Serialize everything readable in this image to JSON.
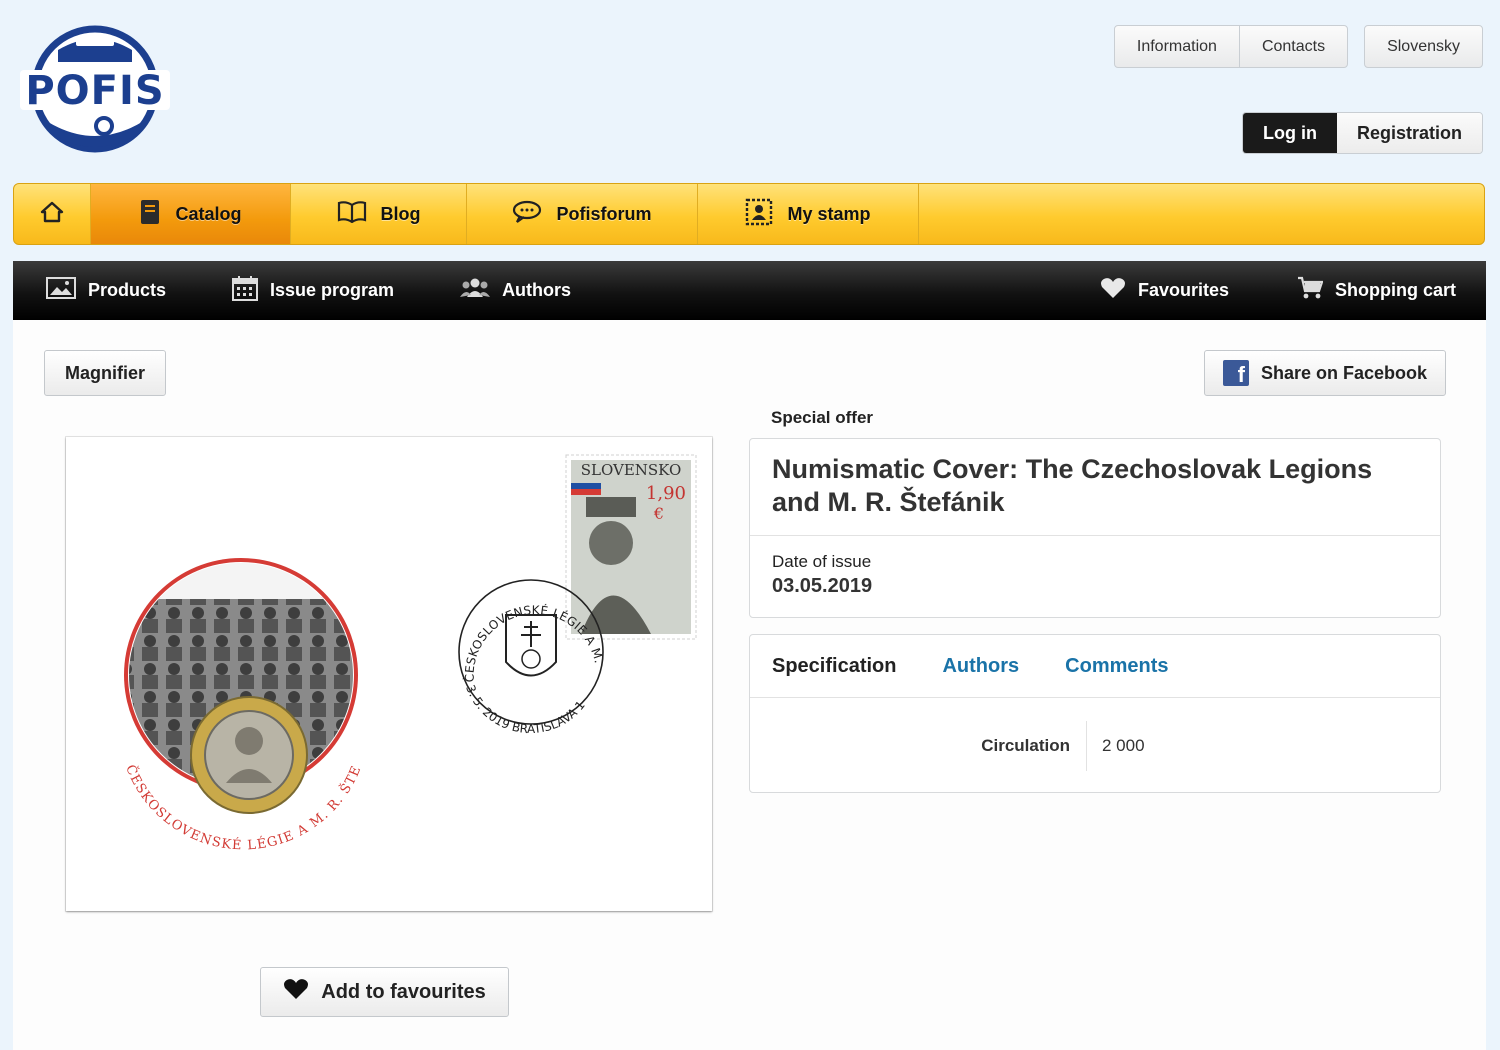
{
  "header": {
    "logo_text": "POFIS",
    "top_links": [
      "Information",
      "Contacts"
    ],
    "language": "Slovensky",
    "login": "Log in",
    "registration": "Registration"
  },
  "main_nav": {
    "items": [
      {
        "label": "Catalog",
        "icon": "catalog-book-icon"
      },
      {
        "label": "Blog",
        "icon": "open-book-icon"
      },
      {
        "label": "Pofisforum",
        "icon": "speech-bubble-icon"
      },
      {
        "label": "My stamp",
        "icon": "stamp-frame-icon"
      }
    ],
    "active": "Catalog"
  },
  "sub_nav": {
    "products": "Products",
    "issue_program": "Issue program",
    "authors": "Authors",
    "favourites": "Favourites",
    "cart": "Shopping cart"
  },
  "toolbar": {
    "magnifier": "Magnifier",
    "share": "Share on Facebook"
  },
  "product": {
    "special_offer": "Special offer",
    "title": "Numismatic Cover: The Czechoslovak Legions and M. R. Štefánik",
    "date_label": "Date of issue",
    "date_value": "03.05.2019",
    "add_favourites": "Add to favourites"
  },
  "cover": {
    "stamp_country": "SLOVENSKO",
    "stamp_value": "1,90",
    "stamp_currency": "€",
    "postmark_text": "ČESKOSLOVENSKÉ LÉGIE A M. R. ŠTEFÁNIK",
    "postmark_date": "3. 5. 2019 BRATISLAVA 1",
    "medal_text": "ČESKOSLOVENSKÉ LÉGIE A M. R. ŠTEFÁNIK"
  },
  "tabs": [
    "Specification",
    "Authors",
    "Comments"
  ],
  "specification": [
    {
      "key": "Circulation",
      "value": "2 000"
    }
  ],
  "colors": {
    "background": "#ebf4fc",
    "nav_yellow": "#ffcb2e",
    "nav_active": "#f39a0c",
    "subnav": "#121212",
    "link": "#1a73a8",
    "logo_blue": "#1c3f8f"
  }
}
